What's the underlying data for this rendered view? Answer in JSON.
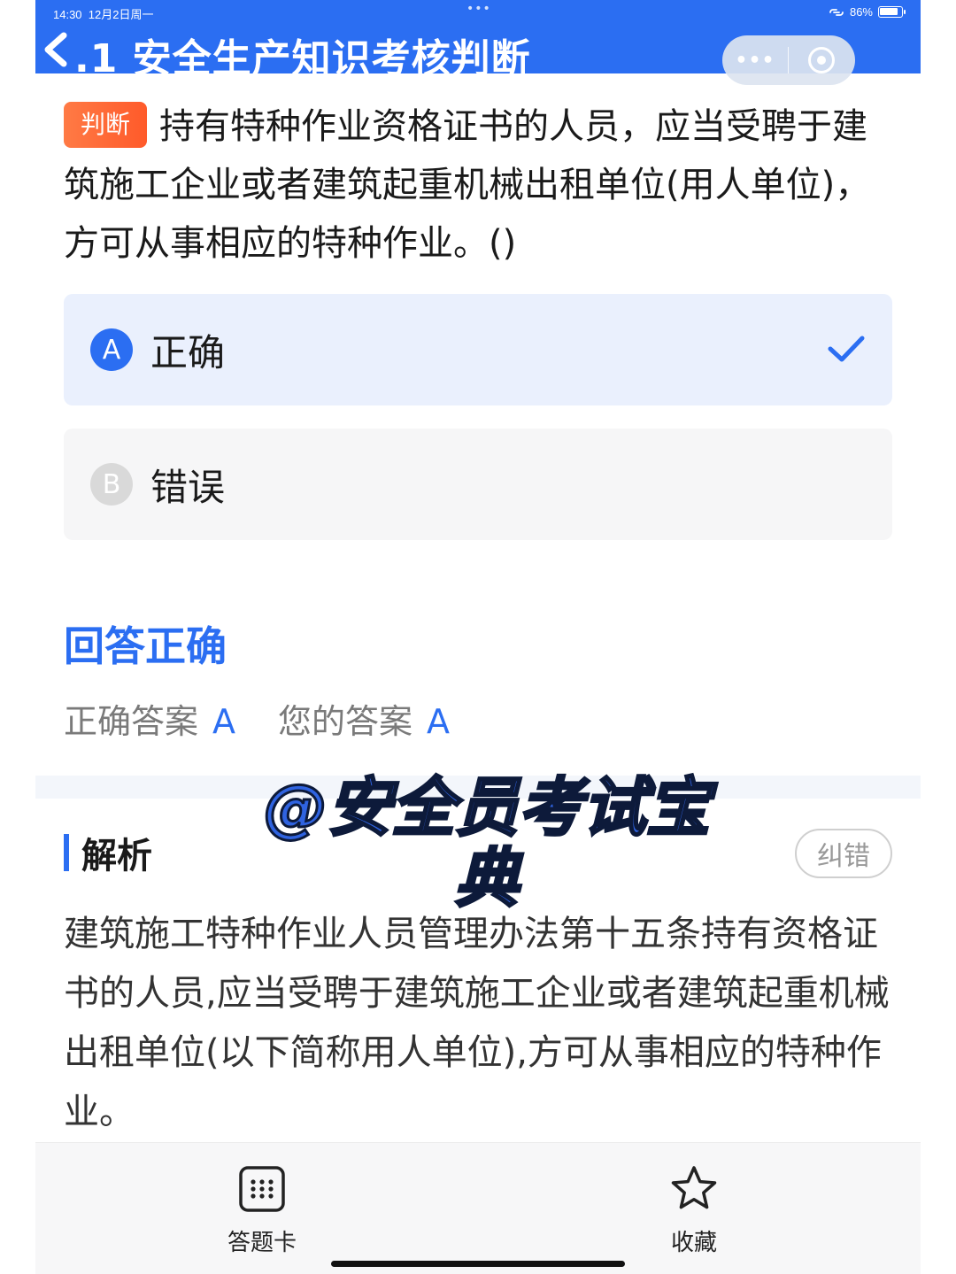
{
  "status_bar": {
    "time": "14:30",
    "date": "12月2日周一",
    "center_dots": "•••",
    "battery": "86%"
  },
  "header": {
    "title": ".1 安全生产知识考核判断",
    "back_icon": "chevron-left-icon",
    "more_label": "•••",
    "accent_color": "#2b6ef2"
  },
  "question": {
    "tag": "判断",
    "text": "持有特种作业资格证书的人员，应当受聘于建筑施工企业或者建筑起重机械出租单位(用人单位)，方可从事相应的特种作业。()"
  },
  "options": [
    {
      "letter": "A",
      "text": "正确",
      "selected": true
    },
    {
      "letter": "B",
      "text": "错误",
      "selected": false
    }
  ],
  "result": {
    "title": "回答正确",
    "correct_label": "正确答案",
    "correct_value": "A",
    "yours_label": "您的答案",
    "yours_value": "A"
  },
  "analysis": {
    "title": "解析",
    "report_label": "纠错",
    "text": "建筑施工特种作业人员管理办法第十五条持有资格证书的人员,应当受聘于建筑施工企业或者建筑起重机械出租单位(以下简称用人单位),方可从事相应的特种作业。"
  },
  "watermark": "@安全员考试宝典",
  "bottom_bar": {
    "card_label": "答题卡",
    "fav_label": "收藏"
  }
}
